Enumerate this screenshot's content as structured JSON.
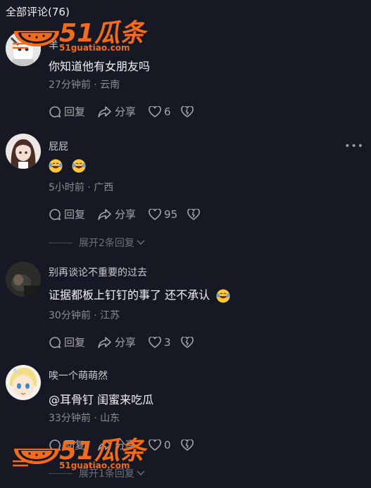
{
  "header": {
    "title": "全部评论(76)"
  },
  "watermark": {
    "brand": "51瓜条",
    "url": "51guatiao.com"
  },
  "comments": [
    {
      "username": "羊 ",
      "content": "你知道他有女朋友吗",
      "meta": "27分钟前 · 云南",
      "reply_label": "回复",
      "share_label": "分享",
      "likes": "6"
    },
    {
      "username": "屁屁",
      "content_emojis": [
        "grinning-tears-emoji",
        "grinning-tears-emoji"
      ],
      "meta": "5小时前 · 广西",
      "reply_label": "回复",
      "share_label": "分享",
      "likes": "95",
      "expand": "展开2条回复"
    },
    {
      "username": "别再谈论不重要的过去",
      "content": "证据都板上钉钉的事了 还不承认",
      "meta": "30分钟前 · 江苏",
      "reply_label": "回复",
      "share_label": "分享",
      "likes": "3"
    },
    {
      "username": "唉一个萌萌然",
      "content": "@耳骨钉  闺蜜来吃瓜",
      "meta": "33分钟前 · 山东",
      "reply_label": "回复",
      "share_label": "分享",
      "likes": "0",
      "expand": "展开1条回复"
    }
  ],
  "colors": {
    "background": "#161823",
    "watermark_orange": "#f26a1b"
  }
}
